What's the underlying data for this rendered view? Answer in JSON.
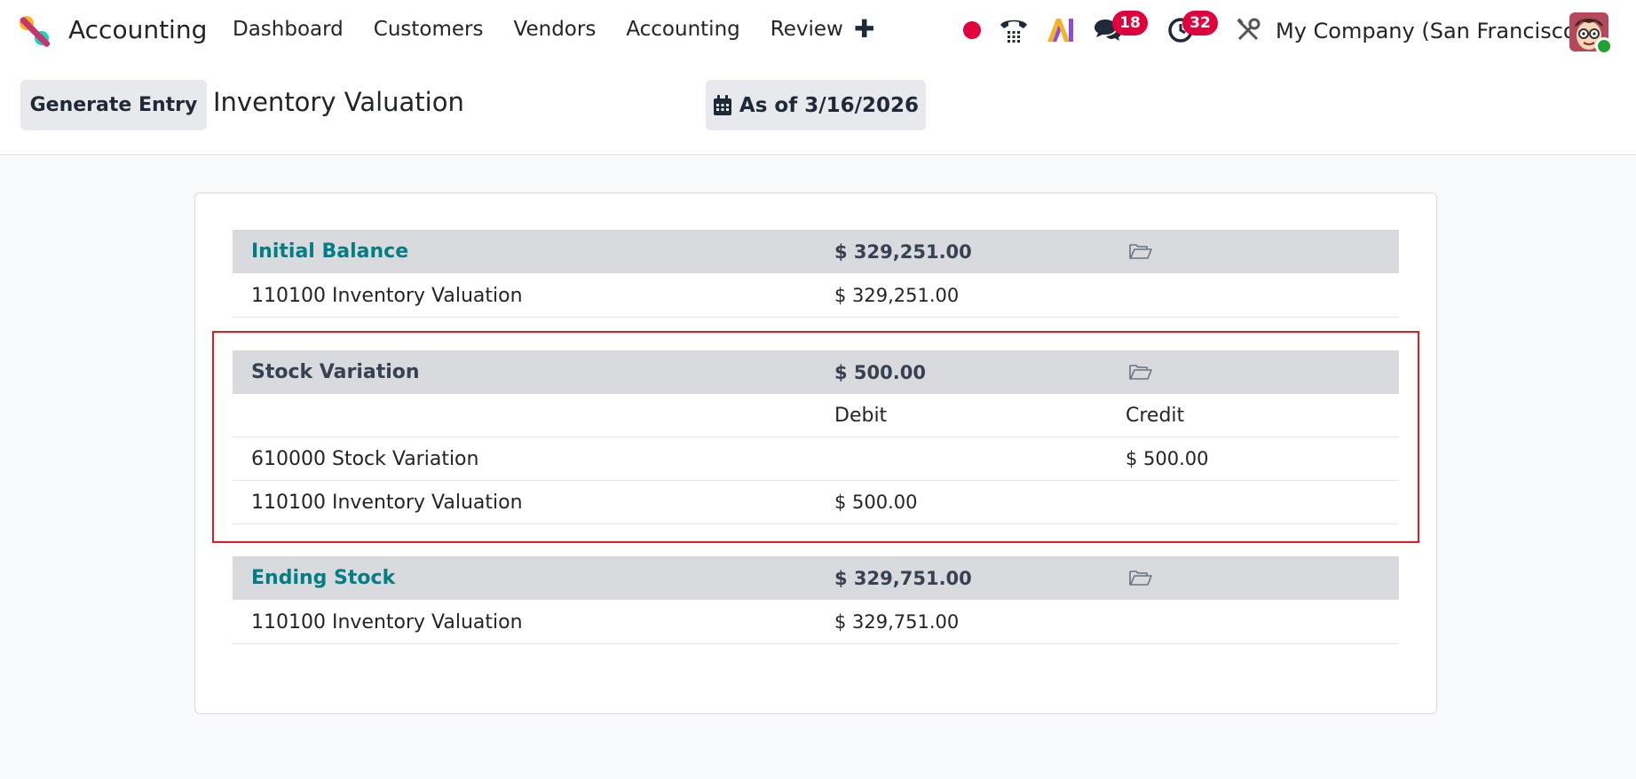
{
  "app": {
    "name": "Accounting",
    "menu": [
      "Dashboard",
      "Customers",
      "Vendors",
      "Accounting",
      "Review"
    ],
    "plus_label": "✚",
    "company": "My Company (San Francisco)",
    "messages_count": "18",
    "activities_count": "32"
  },
  "control": {
    "generate_label": "Generate Entry",
    "title": "Inventory Valuation",
    "date_label": "As of 3/16/2026"
  },
  "report": {
    "initial": {
      "label": "Initial Balance",
      "amount": "$ 329,251.00",
      "line_name": "110100 Inventory Valuation",
      "line_amount": "$ 329,251.00"
    },
    "variation": {
      "label": "Stock Variation",
      "amount": "$ 500.00",
      "debit_header": "Debit",
      "credit_header": "Credit",
      "line1_name": "610000 Stock Variation",
      "line1_credit": "$ 500.00",
      "line2_name": "110100 Inventory Valuation",
      "line2_debit": "$ 500.00"
    },
    "ending": {
      "label": "Ending Stock",
      "amount": "$ 329,751.00",
      "line_name": "110100 Inventory Valuation",
      "line_amount": "$ 329,751.00"
    }
  },
  "colors": {
    "brand_teal": "#017e84",
    "badge_red": "#e0003b",
    "highlight_red": "#e01b24",
    "group_row_bg": "#d9dadd"
  }
}
